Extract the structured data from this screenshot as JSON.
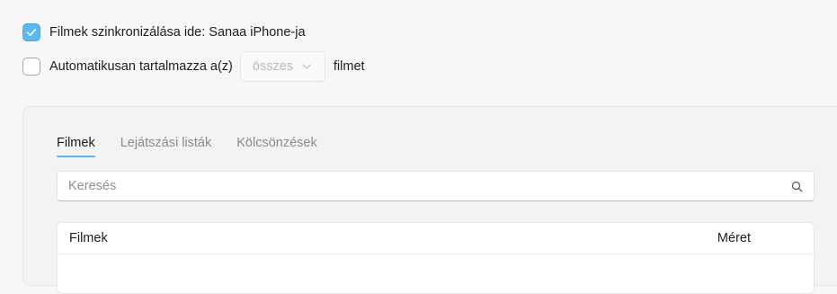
{
  "sync": {
    "checked": true,
    "label": "Filmek szinkronizálása ide: Sanaa iPhone-ja"
  },
  "auto_include": {
    "checked": false,
    "label_prefix": "Automatikusan tartalmazza a(z)",
    "select_value": "összes",
    "label_suffix": "filmet"
  },
  "tabs": [
    {
      "label": "Filmek",
      "active": true
    },
    {
      "label": "Lejátszási listák",
      "active": false
    },
    {
      "label": "Kölcsönzések",
      "active": false
    }
  ],
  "search": {
    "placeholder": "Keresés",
    "value": ""
  },
  "table": {
    "columns": [
      "Filmek",
      "Méret"
    ]
  },
  "colors": {
    "accent": "#5cb8ef",
    "background": "#f7f7f7"
  }
}
